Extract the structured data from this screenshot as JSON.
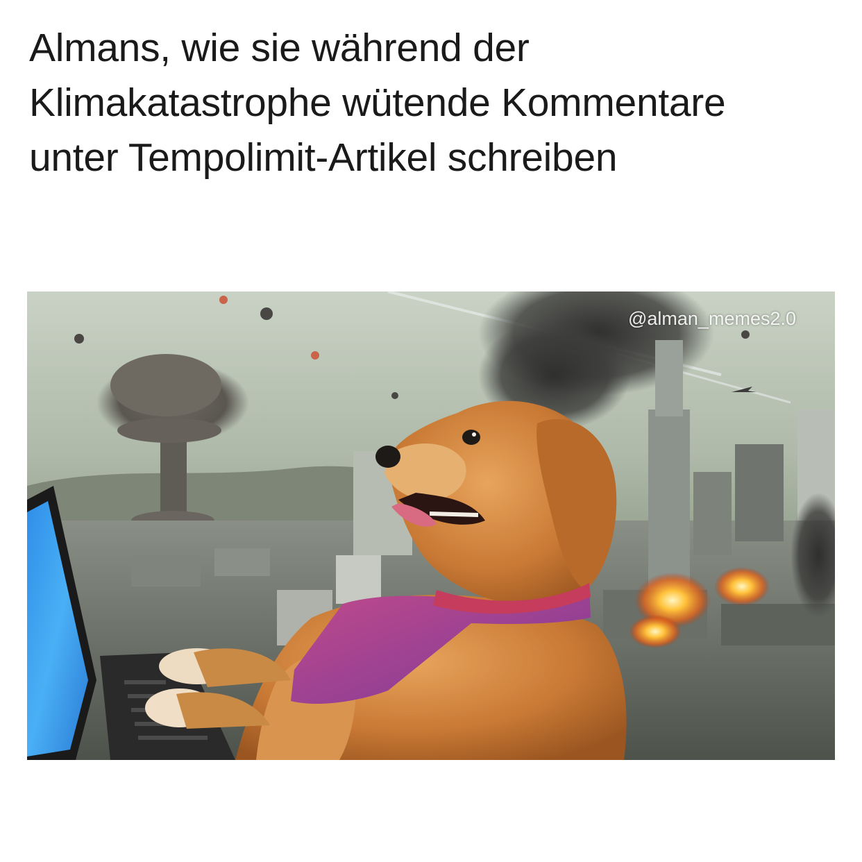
{
  "caption": {
    "line1": "Almans, wie sie während der",
    "line2": "Klimakatastrophe wütende Kommentare",
    "line3": "unter Tempolimit-Artikel schreiben"
  },
  "image": {
    "watermark": "@alman_memes2.0"
  }
}
